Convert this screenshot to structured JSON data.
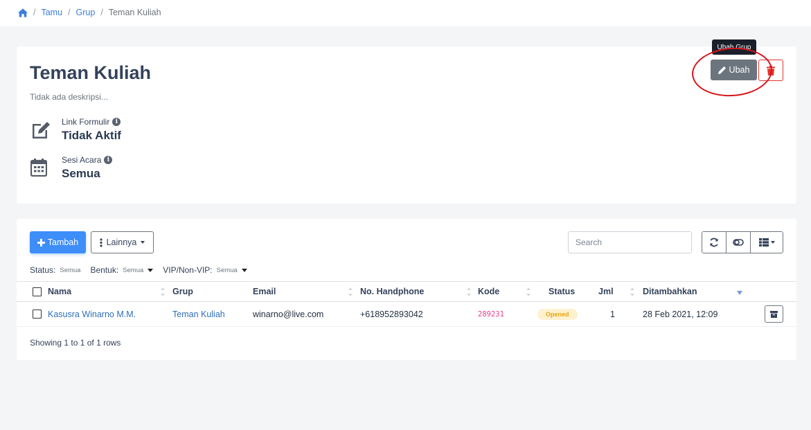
{
  "breadcrumb": {
    "items": [
      "Tamu",
      "Grup"
    ],
    "current": "Teman Kuliah"
  },
  "group": {
    "title": "Teman Kuliah",
    "description": "Tidak ada deskripsi...",
    "form_link": {
      "label": "Link Formulir",
      "value": "Tidak Aktif"
    },
    "session": {
      "label": "Sesi Acara",
      "value": "Semua"
    },
    "edit_label": "Ubah",
    "edit_tooltip": "Ubah Grup"
  },
  "toolbar": {
    "add_label": "Tambah",
    "more_label": "Lainnya",
    "search_placeholder": "Search"
  },
  "filters": [
    {
      "label": "Status:",
      "value": "Semua",
      "has_caret": false
    },
    {
      "label": "Bentuk:",
      "value": "Semua",
      "has_caret": true
    },
    {
      "label": "VIP/Non-VIP:",
      "value": "Semua",
      "has_caret": true
    }
  ],
  "table": {
    "columns": [
      "Nama",
      "Grup",
      "Email",
      "No. Handphone",
      "Kode",
      "Status",
      "Jml",
      "Ditambahkan"
    ],
    "rows": [
      {
        "nama": "Kasusra Winarno M.M.",
        "grup": "Teman Kuliah",
        "email": "winarno@live.com",
        "phone": "+618952893042",
        "kode": "289231",
        "status": "Opened",
        "jml": "1",
        "ditambahkan": "28 Feb 2021, 12:09"
      }
    ],
    "footer": "Showing 1 to 1 of 1 rows"
  },
  "colors": {
    "primary": "#3d8ef8",
    "secondary": "#6c757d",
    "danger": "#e3342f",
    "link": "#2f6fb9",
    "badge_bg": "#fff1cf",
    "badge_text": "#e6a60e",
    "annotation": "#d7141a"
  }
}
